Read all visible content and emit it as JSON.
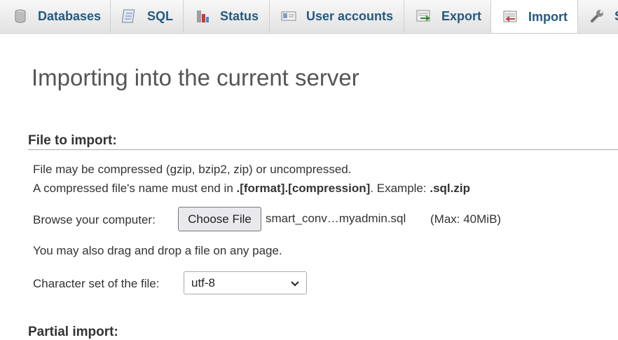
{
  "tabs": [
    {
      "label": "Databases",
      "icon": "database-icon"
    },
    {
      "label": "SQL",
      "icon": "sql-icon"
    },
    {
      "label": "Status",
      "icon": "status-icon"
    },
    {
      "label": "User accounts",
      "icon": "user-accounts-icon"
    },
    {
      "label": "Export",
      "icon": "export-icon"
    },
    {
      "label": "Import",
      "icon": "import-icon",
      "active": true
    },
    {
      "label": "S",
      "icon": "wrench-icon"
    }
  ],
  "main": {
    "title": "Importing into the current server",
    "file_section": {
      "legend": "File to import:",
      "compress_note": "File may be compressed (gzip, bzip2, zip) or uncompressed.",
      "name_note_prefix": "A compressed file's name must end in ",
      "name_note_format": ".[format].[compression]",
      "name_note_mid": ". Example: ",
      "name_note_example": ".sql.zip",
      "browse_label": "Browse your computer:",
      "choose_button": "Choose File",
      "selected_file": "smart_conv…myadmin.sql",
      "max_size": "(Max: 40MiB)",
      "drag_note": "You may also drag and drop a file on any page.",
      "charset_label": "Character set of the file:",
      "charset_value": "utf-8"
    },
    "next_section_legend": "Partial import:"
  },
  "colors": {
    "tab_text": "#235a81",
    "title_text": "#555555"
  }
}
